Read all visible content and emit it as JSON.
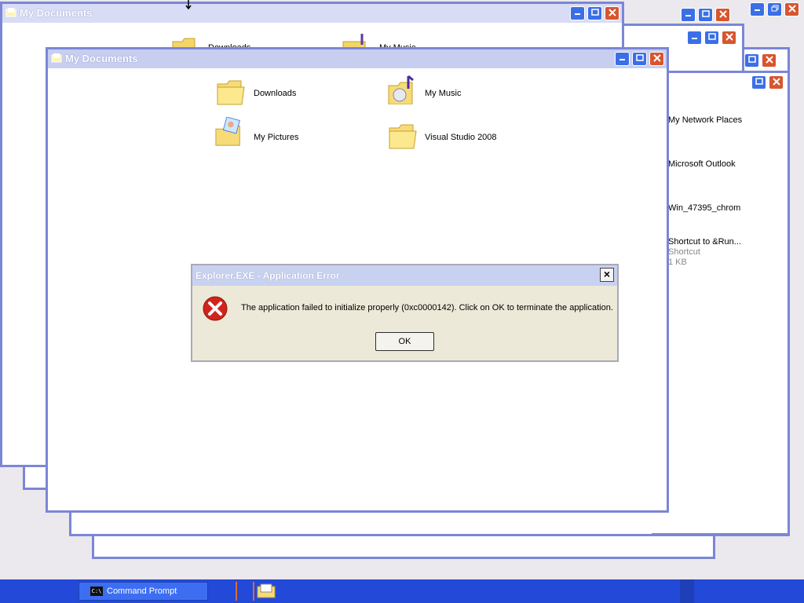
{
  "windows": {
    "back_title": "My Documents",
    "front_title": "My Documents",
    "back_items": [
      "Downloads",
      "My Music"
    ]
  },
  "front": {
    "items": [
      {
        "label": "Downloads",
        "icon": "folder-icon"
      },
      {
        "label": "My Music",
        "icon": "music-folder-icon"
      },
      {
        "label": "My Pictures",
        "icon": "pictures-folder-icon"
      },
      {
        "label": "Visual Studio 2008",
        "icon": "folder-icon"
      }
    ]
  },
  "right_window": {
    "items": [
      {
        "label": "My Network Places"
      },
      {
        "label": "Microsoft Outlook"
      },
      {
        "label": "Win_47395_chrom"
      },
      {
        "label": "Shortcut to &Run...",
        "sub1": "Shortcut",
        "sub2": "1 KB"
      }
    ]
  },
  "dialog": {
    "title": "Explorer.EXE - Application Error",
    "message": "The application failed to initialize properly (0xc0000142). Click on OK to terminate the application.",
    "ok_label": "OK",
    "close_glyph": "×"
  },
  "taskbar": {
    "command_prompt_label": "Command Prompt",
    "cmd_icon_text": "C:\\"
  },
  "colors": {
    "window_border": "#7b86d6",
    "taskbar": "#2349d9",
    "error_red": "#d2241c"
  }
}
